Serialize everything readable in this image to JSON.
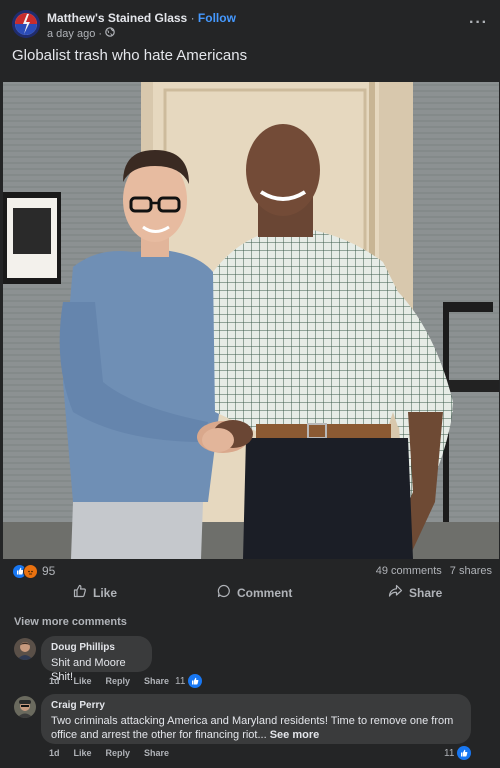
{
  "post": {
    "page_name": "Matthew's Stained Glass",
    "separator": "·",
    "follow_label": "Follow",
    "timestamp": "a day ago ·",
    "text": "Globalist trash who hate Americans",
    "more_icon": "ellipsis-icon",
    "audience_icon": "globe-icon"
  },
  "reactions": {
    "count": "95",
    "types": [
      "like",
      "angry"
    ],
    "comments": "49 comments",
    "shares": "7 shares"
  },
  "actions": {
    "like": "Like",
    "comment": "Comment",
    "share": "Share"
  },
  "comments_section": {
    "view_more": "View more comments",
    "comments": [
      {
        "author": "Doug Phillips",
        "text": "Shit and Moore Shit!",
        "time": "1d",
        "like": "Like",
        "reply": "Reply",
        "share": "Share",
        "reaction_count": "11"
      },
      {
        "author": "Craig Perry",
        "text_line1": "Two criminals attacking America and Maryland residents! Time to remove one from",
        "text_line2": "office and arrest the other for financing riot...",
        "see_more": "See more",
        "time": "1d",
        "like": "Like",
        "reply": "Reply",
        "share": "Share",
        "reaction_count": "11"
      }
    ]
  },
  "colors": {
    "background": "#242526",
    "bubble": "#3a3b3c",
    "accent": "#4599ff",
    "like_blue": "#1877f2",
    "secondary_text": "#b0b3b8"
  }
}
